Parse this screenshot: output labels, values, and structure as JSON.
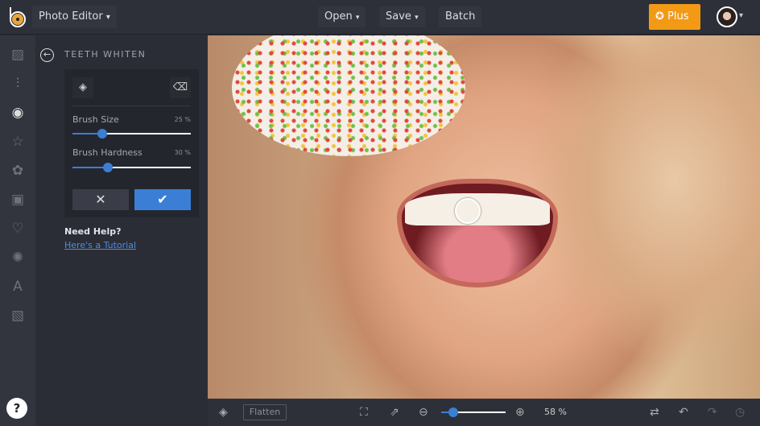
{
  "header": {
    "app_menu": "Photo Editor",
    "open": "Open",
    "save": "Save",
    "batch": "Batch",
    "plus": "Plus",
    "chevron": "⌄"
  },
  "rail": {
    "icons": [
      "image-icon",
      "sliders-icon",
      "eye-icon",
      "star-icon",
      "flower-icon",
      "frame-icon",
      "heart-icon",
      "badge-icon",
      "text-icon",
      "texture-icon"
    ],
    "help": "?"
  },
  "panel": {
    "title": "TEETH WHITEN",
    "brush_size_label": "Brush Size",
    "brush_size_value": "25 %",
    "brush_size": 25,
    "brush_hardness_label": "Brush Hardness",
    "brush_hardness_value": "30 %",
    "brush_hardness": 30,
    "need_help": "Need Help?",
    "tutorial_link": "Here's a Tutorial"
  },
  "bottom": {
    "flatten": "Flatten",
    "zoom": "58 %"
  },
  "colors": {
    "accent": "#3b7fd4",
    "plus": "#f29a15"
  }
}
